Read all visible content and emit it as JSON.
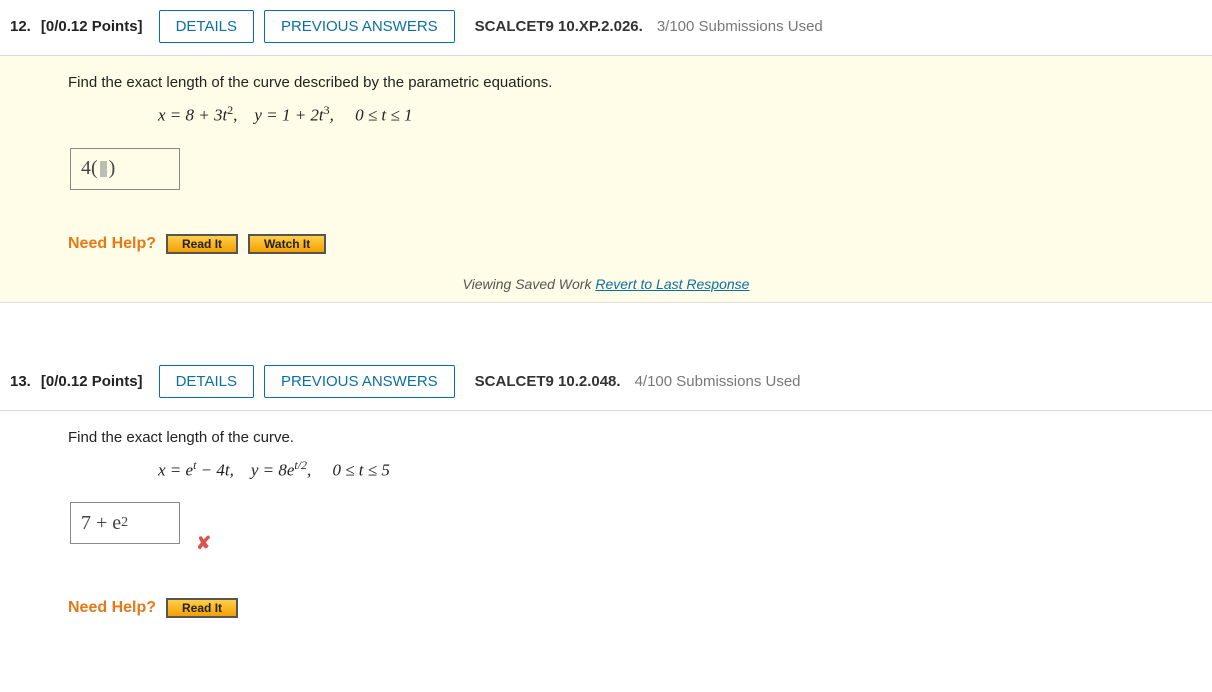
{
  "q12": {
    "number": "12.",
    "points": "[0/0.12 Points]",
    "details_btn": "DETAILS",
    "prev_btn": "PREVIOUS ANSWERS",
    "ref": "SCALCET9 10.XP.2.026.",
    "subs": "3/100 Submissions Used",
    "prompt": "Find the exact length of the curve described by the parametric equations.",
    "equation_pre": "x = 8 + 3t",
    "equation_mid": ", y = 1 + 2t",
    "equation_post": ",  0 ≤ t ≤ 1",
    "answer_prefix": "4(",
    "answer_suffix": ")",
    "need_help": "Need Help?",
    "read_it": "Read It",
    "watch_it": "Watch It"
  },
  "saved_work": {
    "prefix": "Viewing Saved Work ",
    "link": "Revert to Last Response"
  },
  "q13": {
    "number": "13.",
    "points": "[0/0.12 Points]",
    "details_btn": "DETAILS",
    "prev_btn": "PREVIOUS ANSWERS",
    "ref": "SCALCET9 10.2.048.",
    "subs": "4/100 Submissions Used",
    "prompt": "Find the exact length of the curve.",
    "eq_a": "x = e",
    "eq_b": " − 4t, y = 8e",
    "eq_c": ",  0 ≤ t ≤ 5",
    "answer": "7 + e",
    "need_help": "Need Help?",
    "read_it": "Read It"
  }
}
